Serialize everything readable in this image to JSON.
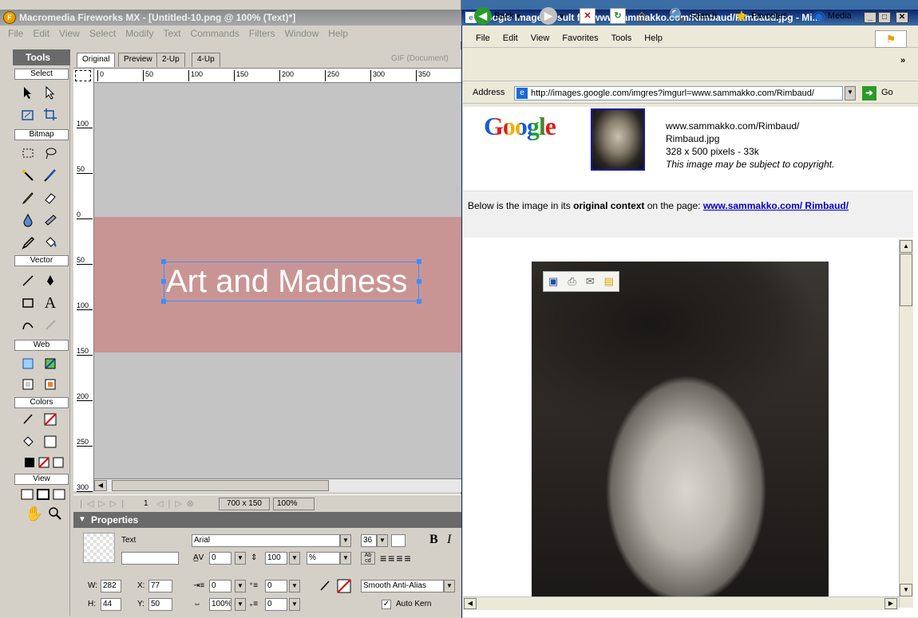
{
  "fireworks": {
    "title": "Macromedia Fireworks MX - [Untitled-10.png @ 100% (Text)*]",
    "menu": [
      "File",
      "Edit",
      "View",
      "Select",
      "Modify",
      "Text",
      "Commands",
      "Filters",
      "Window",
      "Help"
    ],
    "tools_title": "Tools",
    "sections": [
      "Select",
      "Bitmap",
      "Vector",
      "Web",
      "Colors",
      "View"
    ],
    "tabs": [
      "Original",
      "Preview",
      "2-Up",
      "4-Up"
    ],
    "export_format": "GIF (Document)",
    "ruler_top": [
      "0",
      "50",
      "100",
      "150",
      "200",
      "250",
      "300",
      "350"
    ],
    "ruler_left": [
      "100",
      "50",
      "0",
      "50",
      "100",
      "150",
      "200",
      "250",
      "300"
    ],
    "canvas_text": "Art and Madness",
    "status": {
      "frame": "1",
      "size": "700 x 150",
      "zoom": "100%"
    },
    "properties": {
      "title": "Properties",
      "type_label": "Text",
      "font": "Arial",
      "size": "36",
      "kerning": "0",
      "leading": "100",
      "leading_unit": "%",
      "w_label": "W:",
      "w": "282",
      "h_label": "H:",
      "h": "44",
      "x_label": "X:",
      "x": "77",
      "y_label": "Y:",
      "y": "50",
      "indent": "0",
      "space_before": "0",
      "space_after": "0",
      "horiz_scale": "100%",
      "baseline_shift": "0",
      "anti_alias": "Smooth Anti-Alias",
      "auto_kern": "Auto Kern",
      "bold": "B",
      "italic": "I"
    }
  },
  "ie": {
    "title": "Google Image Result for www.sammakko.com/Rimbaud/Rimbaud.jpg - Mi...",
    "menu": [
      "File",
      "Edit",
      "View",
      "Favorites",
      "Tools",
      "Help"
    ],
    "toolbar": {
      "back": "Back",
      "search": "Search",
      "favorites": "Favorites",
      "media": "Media"
    },
    "address_label": "Address",
    "address": "http://images.google.com/imgres?imgurl=www.sammakko.com/Rimbaud/",
    "go": "Go",
    "google_logo": "Google",
    "info": {
      "url1": "www.sammakko.com/Rimbaud/",
      "url2": "Rimbaud.jpg",
      "dims": "328 x 500 pixels - 33k",
      "note": "This image may be subject to copyright."
    },
    "context": {
      "prefix": "Below is the image in its ",
      "bold": "original context",
      "middle": " on the page: ",
      "link": "www.sammakko.com/ Rimbaud/"
    }
  }
}
